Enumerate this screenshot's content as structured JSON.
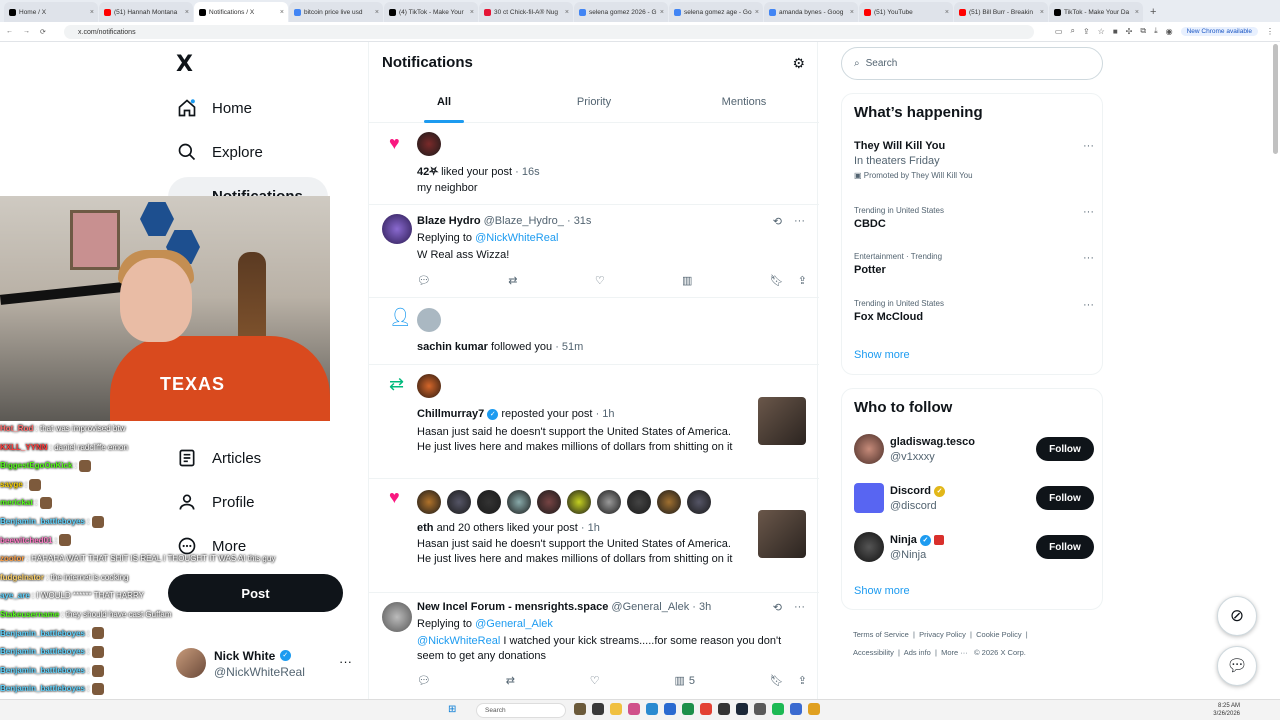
{
  "browser": {
    "tabs": [
      {
        "title": "Home / X",
        "color": "#000000",
        "active": false
      },
      {
        "title": "(51) Hannah Montana",
        "color": "#ff0000",
        "active": false
      },
      {
        "title": "Notifications / X",
        "color": "#000000",
        "active": true
      },
      {
        "title": "bitcoin price live usd",
        "color": "#4285f4",
        "active": false
      },
      {
        "title": "(4) TikTok - Make Your",
        "color": "#000000",
        "active": false
      },
      {
        "title": "30 ct Chick-fil-A® Nug",
        "color": "#e51636",
        "active": false
      },
      {
        "title": "selena gomez 2026 - G",
        "color": "#4285f4",
        "active": false
      },
      {
        "title": "selena gomez age - Go",
        "color": "#4285f4",
        "active": false
      },
      {
        "title": "amanda bynes - Goog",
        "color": "#4285f4",
        "active": false
      },
      {
        "title": "(51) YouTube",
        "color": "#ff0000",
        "active": false
      },
      {
        "title": "(51) Bill Burr - Breakin",
        "color": "#ff0000",
        "active": false
      },
      {
        "title": "TikTok - Make Your Da",
        "color": "#000000",
        "active": false
      }
    ],
    "new_tab": "+",
    "url": "x.com/notifications",
    "chrome_pill": "New Chrome available"
  },
  "nav": {
    "logo": "X",
    "items": [
      {
        "label": "Home",
        "icon": "home-icon"
      },
      {
        "label": "Explore",
        "icon": "search-icon"
      },
      {
        "label": "Notifications",
        "icon": "bell-icon"
      },
      {
        "label": "Articles",
        "icon": "article-icon"
      },
      {
        "label": "Profile",
        "icon": "person-icon"
      },
      {
        "label": "More",
        "icon": "more-circle-icon"
      }
    ],
    "post_label": "Post",
    "account": {
      "name": "Nick White",
      "handle": "@NickWhiteReal"
    }
  },
  "stream_overlay": {
    "shirt_text": "TEXAS",
    "chat": [
      {
        "user": "Hot_Rod",
        "color": "#ff6b6b",
        "msg": "that was improvised btw"
      },
      {
        "user": "KXLL_YYNN",
        "color": "#ff3b3b",
        "msg": "daniel radcliffe emon"
      },
      {
        "user": "BiggestEgoOnKick",
        "color": "#53fc18",
        "msg": ""
      },
      {
        "user": "sayge",
        "color": "#f5d000",
        "msg": ""
      },
      {
        "user": "merickat",
        "color": "#53fc18",
        "msg": ""
      },
      {
        "user": "Benjamin_battleboyes",
        "color": "#5fd4ff",
        "msg": ""
      },
      {
        "user": "beewitched01",
        "color": "#ff79c6",
        "msg": ""
      },
      {
        "user": "zootor",
        "color": "#ff9f43",
        "msg": "HAHAHA WAIT THAT SHIT IS REAL I THOUGHT IT WAS AI this guy"
      },
      {
        "user": "fudgelnator",
        "color": "#ffd36b",
        "msg": "the internet is cooking"
      },
      {
        "user": "aye_are",
        "color": "#5fd4ff",
        "msg": "I WOULD ****** THAT HARRY"
      },
      {
        "user": "Stakeusername",
        "color": "#53fc18",
        "msg": "they should have cast Guffam"
      },
      {
        "user": "Benjamin_battleboyes",
        "color": "#5fd4ff",
        "msg": ""
      },
      {
        "user": "Benjamin_battleboyes",
        "color": "#5fd4ff",
        "msg": ""
      },
      {
        "user": "Benjamin_battleboyes",
        "color": "#5fd4ff",
        "msg": ""
      },
      {
        "user": "Benjamin_battleboyes",
        "color": "#5fd4ff",
        "msg": ""
      }
    ]
  },
  "notifications": {
    "title": "Notifications",
    "tabs": [
      "All",
      "Priority",
      "Mentions"
    ],
    "items": {
      "like1": {
        "user": "42⛧",
        "action": "liked your post",
        "time": "· 16s",
        "preview": "my neighbor"
      },
      "reply1": {
        "name": "Blaze Hydro",
        "handle": "@Blaze_Hydro_",
        "time": "· 31s",
        "replying_label": "Replying to",
        "replying_to": "@NickWhiteReal",
        "text": "W Real ass Wizza!"
      },
      "follow1": {
        "user": "sachin kumar",
        "action": "followed you",
        "time": "· 51m"
      },
      "repost1": {
        "user": "Chillmurray7",
        "action": "reposted your post",
        "time": "· 1h",
        "text": "Hasan just said he doesn't support the United States of America. He just lives here and makes millions of dollars from shitting on it"
      },
      "like2": {
        "user": "eth",
        "action": "and 20 others liked your post",
        "time": "· 1h",
        "text": "Hasan just said he doesn't support the United States of America. He just lives here and makes millions of dollars from shitting on it"
      },
      "reply2": {
        "name": "New Incel Forum - mensrights.space",
        "handle": "@General_Alek",
        "time": "· 3h",
        "replying_label": "Replying to",
        "replying_to": "@General_Alek",
        "mention": "@NickWhiteReal",
        "text": " I watched your kick streams.....for some reason you don't seem to get any donations",
        "views": "5"
      }
    }
  },
  "sidebar": {
    "search_placeholder": "Search",
    "whats_happening": {
      "title": "What’s happening",
      "promo": {
        "name": "They Will Kill You",
        "sub": "In theaters Friday",
        "promoted": "Promoted by They Will Kill You"
      },
      "trends": [
        {
          "meta": "Trending in United States",
          "name": "CBDC"
        },
        {
          "meta": "Entertainment · Trending",
          "name": "Potter"
        },
        {
          "meta": "Trending in United States",
          "name": "Fox McCloud"
        }
      ],
      "show_more": "Show more"
    },
    "who_to_follow": {
      "title": "Who to follow",
      "accounts": [
        {
          "name": "gladiswag.tesco",
          "handle": "@v1xxxy",
          "button": "Follow",
          "avatar_color": "#5b3a32"
        },
        {
          "name": "Discord",
          "handle": "@discord",
          "button": "Follow",
          "avatar_color": "#5865f2"
        },
        {
          "name": "Ninja",
          "handle": "@Ninja",
          "button": "Follow",
          "avatar_color": "#1c1c1c"
        }
      ],
      "show_more": "Show more"
    },
    "footer": {
      "links": [
        "Terms of Service",
        "Privacy Policy",
        "Cookie Policy",
        "Accessibility",
        "Ads info",
        "More ···"
      ],
      "copyright": "© 2026 X Corp."
    }
  },
  "taskbar": {
    "search": "Search",
    "time": "8:25 AM",
    "date": "3/26/2026"
  },
  "colors": {
    "accent": "#1d9bf0",
    "like": "#f91880",
    "repost": "#00ba7c"
  }
}
